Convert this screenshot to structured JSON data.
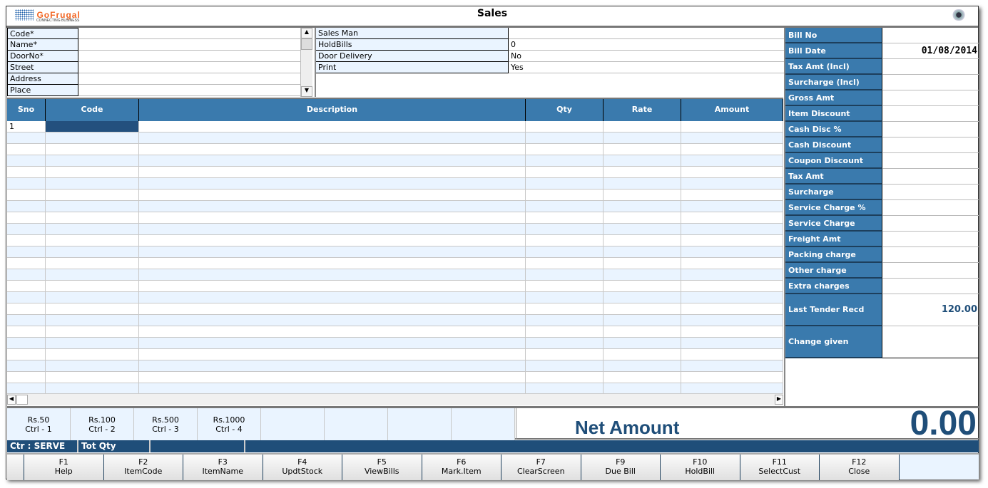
{
  "window": {
    "title": "Sales",
    "logo_brand": "GoFrugal",
    "logo_tagline": "CONNECTING BUSINESS"
  },
  "customer": {
    "fields": [
      {
        "label": "Code*",
        "value": ""
      },
      {
        "label": "Name*",
        "value": ""
      },
      {
        "label": "DoorNo*",
        "value": ""
      },
      {
        "label": "Street",
        "value": ""
      },
      {
        "label": "Address",
        "value": ""
      },
      {
        "label": "Place",
        "value": ""
      }
    ]
  },
  "sale_info": [
    {
      "label": "Sales Man",
      "value": ""
    },
    {
      "label": "HoldBills",
      "value": "0"
    },
    {
      "label": "Door Delivery",
      "value": "No"
    },
    {
      "label": "Print",
      "value": "Yes"
    }
  ],
  "grid": {
    "columns": [
      "Sno",
      "Code",
      "Description",
      "Qty",
      "Rate",
      "Amount"
    ],
    "rows": [
      [
        "1",
        "",
        "",
        "",
        "",
        ""
      ]
    ],
    "empty_rows": 23
  },
  "summary": [
    {
      "label": "Bill No",
      "value": ""
    },
    {
      "label": "Bill Date",
      "value": "01/08/2014"
    },
    {
      "label": "Tax Amt (Incl)",
      "value": ""
    },
    {
      "label": "Surcharge (Incl)",
      "value": ""
    },
    {
      "label": "Gross Amt",
      "value": ""
    },
    {
      "label": "Item Discount",
      "value": ""
    },
    {
      "label": "Cash Disc %",
      "value": ""
    },
    {
      "label": "Cash Discount",
      "value": ""
    },
    {
      "label": "Coupon Discount",
      "value": ""
    },
    {
      "label": "Tax Amt",
      "value": ""
    },
    {
      "label": "Surcharge",
      "value": ""
    },
    {
      "label": "Service Charge %",
      "value": ""
    },
    {
      "label": "Service Charge",
      "value": ""
    },
    {
      "label": "Freight Amt",
      "value": ""
    },
    {
      "label": "Packing charge",
      "value": ""
    },
    {
      "label": "Other charge",
      "value": ""
    },
    {
      "label": "Extra charges",
      "value": ""
    }
  ],
  "tender": {
    "last_label": "Last Tender Recd",
    "last_value": "120.00",
    "change_label": "Change given",
    "change_value": ""
  },
  "denominations": [
    {
      "amount": "Rs.50",
      "shortcut": "Ctrl - 1"
    },
    {
      "amount": "Rs.100",
      "shortcut": "Ctrl - 2"
    },
    {
      "amount": "Rs.500",
      "shortcut": "Ctrl - 3"
    },
    {
      "amount": "Rs.1000",
      "shortcut": "Ctrl - 4"
    }
  ],
  "net": {
    "label": "Net Amount",
    "value": "0.00"
  },
  "status": {
    "counter": "Ctr : SERVE",
    "tot_qty": "Tot Qty"
  },
  "fkeys": [
    {
      "key": "F1",
      "label": "Help"
    },
    {
      "key": "F2",
      "label": "ItemCode"
    },
    {
      "key": "F3",
      "label": "ItemName"
    },
    {
      "key": "F4",
      "label": "UpdtStock"
    },
    {
      "key": "F5",
      "label": "ViewBills"
    },
    {
      "key": "F6",
      "label": "Mark.Item"
    },
    {
      "key": "F7",
      "label": "ClearScreen"
    },
    {
      "key": "F9",
      "label": "Due Bill"
    },
    {
      "key": "F10",
      "label": "HoldBill"
    },
    {
      "key": "F11",
      "label": "SelectCust"
    },
    {
      "key": "F12",
      "label": "Close"
    }
  ]
}
